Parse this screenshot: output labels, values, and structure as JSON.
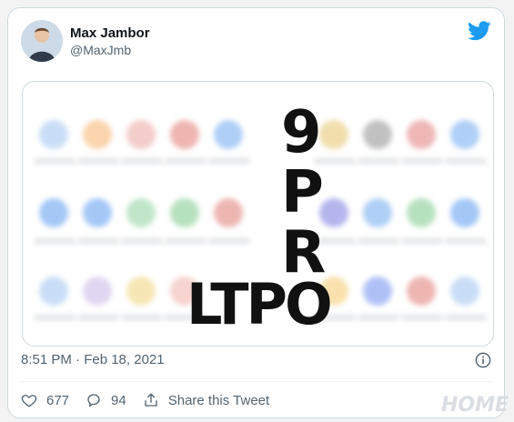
{
  "tweet": {
    "author_name": "Max Jambor",
    "author_handle": "@MaxJmb",
    "media_text": {
      "line1": "9",
      "line2": "P",
      "line3": "R",
      "line4": "LTPO"
    },
    "timestamp": "8:51 PM · Feb 18, 2021",
    "likes": "677",
    "replies": "94",
    "share_label": "Share this Tweet"
  },
  "watermark": "HOME",
  "colors": {
    "twitter_blue": "#1d9bf0",
    "muted_text": "#536471",
    "border": "#cfd9de"
  },
  "icons": [
    "twitter-bird-icon",
    "info-icon",
    "heart-icon",
    "reply-icon",
    "share-icon"
  ]
}
